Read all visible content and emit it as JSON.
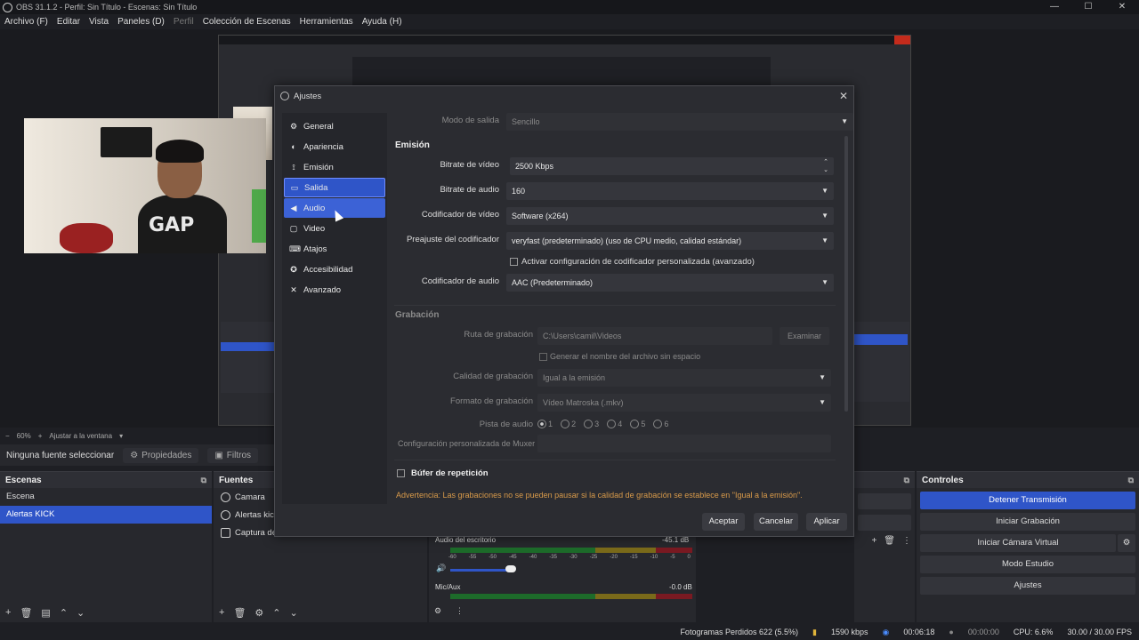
{
  "titlebar": {
    "title": "OBS 31.1.2 - Perfil: Sin Título - Escenas: Sin Título",
    "controls": [
      "—",
      "☐",
      "✕"
    ]
  },
  "menu": [
    "Archivo (F)",
    "Editar",
    "Vista",
    "Paneles (D)",
    "Perfil",
    "Colección de Escenas",
    "Herramientas",
    "Ayuda (H)"
  ],
  "preview": {
    "zoom": "60%",
    "zoom_mode": "Ajustar a la ventana"
  },
  "sourcebar": {
    "no_source": "Ninguna fuente seleccionar",
    "properties": "Propiedades",
    "filters": "Filtros"
  },
  "scenes": {
    "title": "Escenas",
    "items": [
      "Escena",
      "Alertas KICK"
    ],
    "selected": 1
  },
  "sources": {
    "title": "Fuentes",
    "items": [
      "Camara",
      "Alertas kick",
      "Captura de"
    ]
  },
  "mixer": {
    "channels": [
      {
        "name": "Audio del escritorio",
        "db": "-45.1 dB"
      },
      {
        "name": "Mic/Aux",
        "db": "-0.0 dB"
      }
    ],
    "scale": [
      "-60",
      "-55",
      "-50",
      "-45",
      "-40",
      "-35",
      "-30",
      "-25",
      "-20",
      "-15",
      "-10",
      "-5",
      "0"
    ]
  },
  "controls": {
    "title": "Controles",
    "buttons": [
      "Detener Transmisión",
      "Iniciar Grabación",
      "Iniciar Cámara Virtual",
      "Modo Estudio",
      "Ajustes"
    ]
  },
  "status": {
    "dropped": "Fotogramas Perdidos 622 (5.5%)",
    "bitrate": "1590 kbps",
    "stream_time": "00:06:18",
    "rec_time": "00:00:00",
    "cpu": "CPU: 6.6%",
    "fps": "30.00 / 30.00 FPS"
  },
  "dialog": {
    "title": "Ajustes",
    "nav": [
      {
        "label": "General",
        "icon": "gear-icon"
      },
      {
        "label": "Apariencia",
        "icon": "palette-icon"
      },
      {
        "label": "Emisión",
        "icon": "broadcast-icon"
      },
      {
        "label": "Salida",
        "icon": "output-icon"
      },
      {
        "label": "Audio",
        "icon": "speaker-icon"
      },
      {
        "label": "Video",
        "icon": "monitor-icon"
      },
      {
        "label": "Atajos",
        "icon": "keyboard-icon"
      },
      {
        "label": "Accesibilidad",
        "icon": "accessibility-icon"
      },
      {
        "label": "Avanzado",
        "icon": "wrench-icon"
      }
    ],
    "selected_nav": "Salida",
    "output_mode": {
      "label": "Modo de salida",
      "value": "Sencillo"
    },
    "streaming": {
      "title": "Emisión",
      "video_bitrate": {
        "label": "Bitrate de vídeo",
        "value": "2500 Kbps"
      },
      "audio_bitrate": {
        "label": "Bitrate de audio",
        "value": "160"
      },
      "video_encoder": {
        "label": "Codificador de vídeo",
        "value": "Software (x264)"
      },
      "preset": {
        "label": "Preajuste del codificador",
        "value": "veryfast (predeterminado) (uso de CPU medio, calidad estándar)"
      },
      "custom_settings": "Activar configuración de codificador personalizada (avanzado)",
      "audio_encoder": {
        "label": "Codificador de audio",
        "value": "AAC (Predeterminado)"
      }
    },
    "recording": {
      "title": "Grabación",
      "path": {
        "label": "Ruta de grabación",
        "value": "C:\\Users\\camil\\Videos"
      },
      "browse": "Examinar",
      "no_space": "Generar el nombre del archivo sin espacio",
      "quality": {
        "label": "Calidad de grabación",
        "value": "Igual a la emisión"
      },
      "format": {
        "label": "Formato de grabación",
        "value": "Vídeo Matroska (.mkv)"
      },
      "tracks_label": "Pista de audio",
      "tracks": [
        "1",
        "2",
        "3",
        "4",
        "5",
        "6"
      ],
      "muxer": {
        "label": "Configuración personalizada de Muxer",
        "value": ""
      }
    },
    "replay_buffer": "Búfer de repetición",
    "warning": "Advertencia: Las grabaciones no se pueden pausar si la calidad de grabación se establece en \"Igual a la emisión\".",
    "buttons": {
      "accept": "Aceptar",
      "cancel": "Cancelar",
      "apply": "Aplicar"
    }
  },
  "colors": {
    "accent": "#2f55c8",
    "warning": "#d89a4a",
    "bg": "#1e1f24"
  }
}
